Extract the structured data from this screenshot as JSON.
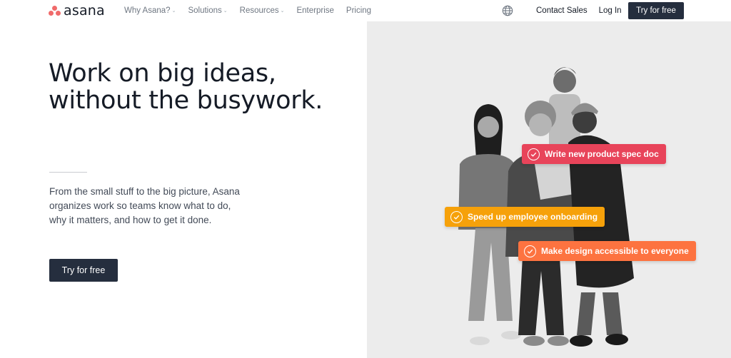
{
  "nav": {
    "logo_text": "asana",
    "menu": [
      {
        "label": "Why Asana?",
        "dropdown": true
      },
      {
        "label": "Solutions",
        "dropdown": true
      },
      {
        "label": "Resources",
        "dropdown": true
      },
      {
        "label": "Enterprise",
        "dropdown": false
      },
      {
        "label": "Pricing",
        "dropdown": false
      }
    ],
    "globe_icon": "globe-icon",
    "contact_sales": "Contact Sales",
    "log_in": "Log In",
    "try_free": "Try for free"
  },
  "hero": {
    "headline_line1": "Work on big ideas,",
    "headline_line2": "without the busywork.",
    "subtext_line1": "From the small stuff to the big picture, Asana",
    "subtext_line2": "organizes work so teams know what to do,",
    "subtext_line3": "why it matters, and how to get it done.",
    "cta": "Try for free"
  },
  "tasks": [
    {
      "label": "Write new product spec doc",
      "color": "#e8445a"
    },
    {
      "label": "Speed up employee onboarding",
      "color": "#f6a10a"
    },
    {
      "label": "Make design accessible to everyone",
      "color": "#fd7340"
    }
  ],
  "colors": {
    "brand_coral": "#f06a6a",
    "dark_button": "#252e3e",
    "panel_bg": "#ececec"
  }
}
